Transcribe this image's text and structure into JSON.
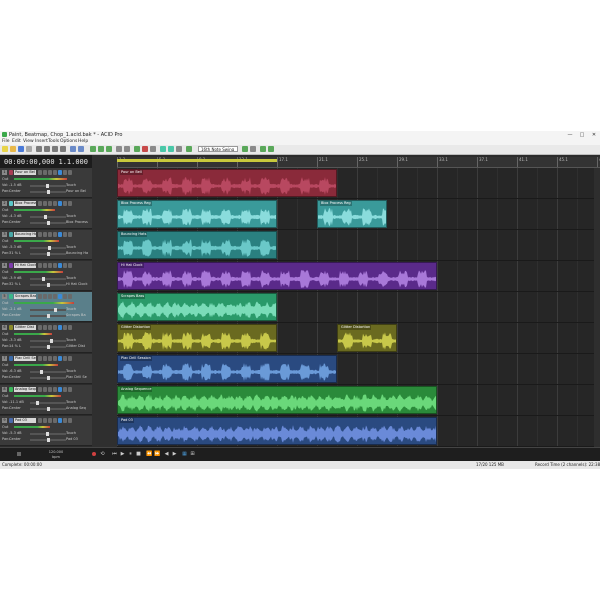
{
  "window": {
    "title": "Paint, Beatmap, Chop_1.acid.bak * - ACID Pro",
    "min": "—",
    "max": "□",
    "close": "✕"
  },
  "menu": [
    "File",
    "Edit",
    "View",
    "Insert",
    "Tools",
    "Options",
    "Help"
  ],
  "toolbar": {
    "snap_dropdown": "16th Note Swing"
  },
  "time": {
    "position": "00:00:00,000",
    "measure": "1.1.000"
  },
  "ruler": [
    "1.1",
    "5.1",
    "9.1",
    "13.1",
    "17.1",
    "21.1",
    "25.1",
    "29.1",
    "33.1",
    "37.1",
    "41.1",
    "45.1",
    "49.1",
    "53.1",
    "57.1"
  ],
  "tracks": [
    {
      "num": "1",
      "name": "Pour on Bel",
      "vol": "-1.5 dB",
      "pan": "Center",
      "touch": "Touch",
      "out": "Pour on Bel",
      "color": "#a83c55"
    },
    {
      "num": "2",
      "name": "Blox Process",
      "vol": "-4.3 dB",
      "pan": "Center",
      "touch": "Touch",
      "out": "Blox Process",
      "color": "#5cc8c8"
    },
    {
      "num": "3",
      "name": "Bouncing Hats",
      "vol": "-5.3 dB",
      "pan": "31 % L",
      "touch": "Touch",
      "out": "Bouncing Ha",
      "color": "#4aa8a8"
    },
    {
      "num": "4",
      "name": "Hi Hat Clock",
      "vol": "-3.9 dB",
      "pan": "32 % L",
      "touch": "Touch",
      "out": "Hi Hat Clock",
      "color": "#7c3caa"
    },
    {
      "num": "5",
      "name": "Scrapes Bas",
      "vol": "-2.1 dB",
      "pan": "Center",
      "touch": "Touch",
      "out": "Scrapes Ba",
      "color": "#3ab88a"
    },
    {
      "num": "6",
      "name": "Glitter Dist",
      "vol": "-3.3 dB",
      "pan": "14 % L",
      "touch": "Touch",
      "out": "Glitter Dist",
      "color": "#8a8a2a"
    },
    {
      "num": "7",
      "name": "Plac Drill Ses",
      "vol": "-6.3 dB",
      "pan": "Center",
      "touch": "Touch",
      "out": "Plac Drill Se",
      "color": "#3a6aa8"
    },
    {
      "num": "8",
      "name": "Analog Sequ",
      "vol": "-11.1 dB",
      "pan": "Center",
      "touch": "Touch",
      "out": "Analog Seq",
      "color": "#3ab85a"
    },
    {
      "num": "9",
      "name": "Pad 03",
      "vol": "-5.3 dB",
      "pan": "Center",
      "touch": "Touch",
      "out": "Pad 03",
      "color": "#4a6aaa"
    }
  ],
  "labels": {
    "vol": "Vol:",
    "pan": "Pan:",
    "out": "Out"
  },
  "clips": [
    {
      "track": 0,
      "start": 0,
      "end": 220,
      "name": "Pour on Bell",
      "color": "#8a2a3a",
      "wave": "#b84860"
    },
    {
      "track": 1,
      "start": 0,
      "end": 160,
      "name": "Blox Process Reg",
      "color": "#3a9a9a",
      "wave": "#8adcdc"
    },
    {
      "track": 1,
      "start": 200,
      "end": 270,
      "name": "Blox Process Reg",
      "color": "#3a9a9a",
      "wave": "#8adcdc"
    },
    {
      "track": 2,
      "start": 0,
      "end": 160,
      "name": "Bouncing Hats",
      "color": "#2a8080",
      "wave": "#6ac8c8"
    },
    {
      "track": 3,
      "start": 0,
      "end": 320,
      "name": "Hi Hat Clock",
      "color": "#5a2a8a",
      "wave": "#a878d8"
    },
    {
      "track": 4,
      "start": 0,
      "end": 160,
      "name": "Scrapes Bass",
      "color": "#2a9a6a",
      "wave": "#7adcb8"
    },
    {
      "track": 5,
      "start": 0,
      "end": 160,
      "name": "Glitter Distortion",
      "color": "#6a6a20",
      "wave": "#c8c84a"
    },
    {
      "track": 5,
      "start": 220,
      "end": 280,
      "name": "Glitter Distortion",
      "color": "#6a6a20",
      "wave": "#c8c84a"
    },
    {
      "track": 6,
      "start": 0,
      "end": 220,
      "name": "Plac Drill Session",
      "color": "#2a4a80",
      "wave": "#6a9ad8"
    },
    {
      "track": 7,
      "start": 0,
      "end": 320,
      "name": "Analog Sequence",
      "color": "#2a8a3a",
      "wave": "#6ad87a"
    },
    {
      "track": 8,
      "start": 0,
      "end": 320,
      "name": "Pad 03",
      "color": "#2a4a80",
      "wave": "#6a8ad8"
    }
  ],
  "transport": {
    "tempo": "120.000",
    "tempo_unit": "bpm"
  },
  "status": {
    "left": "Complete: 00:00:00",
    "mid": "17/20 125 MB",
    "right": "Record Time (2 channels): 22:38:35"
  }
}
